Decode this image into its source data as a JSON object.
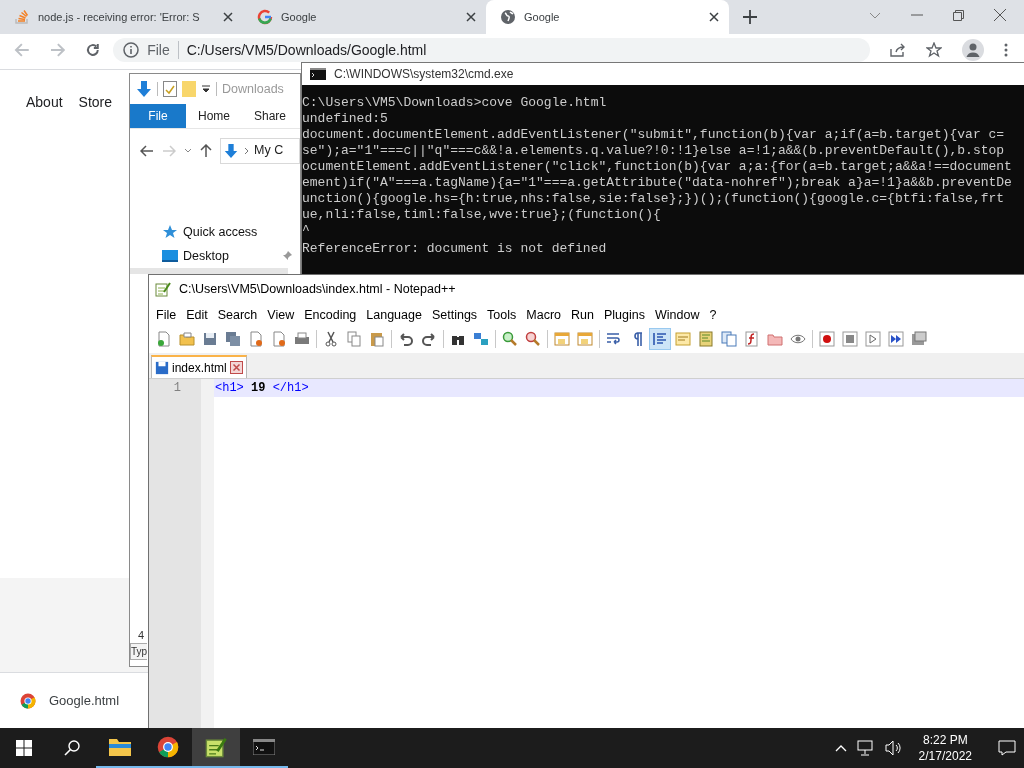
{
  "browser": {
    "tabs": [
      {
        "title": "node.js - receiving error: 'Error: S",
        "kind": "stack",
        "selected": false
      },
      {
        "title": "Google",
        "kind": "logo",
        "selected": false
      },
      {
        "title": "Google",
        "kind": "globe",
        "selected": true
      }
    ],
    "address": {
      "scheme": "File",
      "url": "C:/Users/VM5/Downloads/Google.html"
    },
    "page_links": [
      "About",
      "Store"
    ],
    "download": {
      "file": "Google.html"
    }
  },
  "explorer": {
    "title": "Downloads",
    "ribbon_tabs": [
      {
        "label": "File",
        "selected": true
      },
      {
        "label": "Home",
        "selected": false
      },
      {
        "label": "Share",
        "selected": false
      }
    ],
    "path": "My C",
    "nav": [
      {
        "label": "Quick access",
        "kind": "star",
        "pinned": false
      },
      {
        "label": "Desktop",
        "kind": "desktop",
        "pinned": true
      }
    ],
    "status_count": "4",
    "column_header": "Typ"
  },
  "console": {
    "title": "C:\\WINDOWS\\system32\\cmd.exe",
    "lines": [
      "C:\\Users\\VM5\\Downloads>cove Google.html",
      "undefined:5",
      "document.documentElement.addEventListener(\"submit\",function(b){var a;if(a=b.target){var c=",
      "se\");a=\"1\"===c||\"q\"===c&&!a.elements.q.value?!0:!1}else a=!1;a&&(b.preventDefault(),b.stop",
      "ocumentElement.addEventListener(\"click\",function(b){var a;a:{for(a=b.target;a&&a!==document",
      "ement)if(\"A\"===a.tagName){a=\"1\"===a.getAttribute(\"data-nohref\");break a}a=!1}a&&b.preventDe",
      "unction(){google.hs={h:true,nhs:false,sie:false};})();(function(){google.c={btfi:false,frt",
      "ue,nli:false,timl:false,wve:true};(function(){",
      "^"
    ],
    "error": "ReferenceError: document is not defined"
  },
  "notepad": {
    "title": "C:\\Users\\VM5\\Downloads\\index.html - Notepad++",
    "menu": [
      "File",
      "Edit",
      "Search",
      "View",
      "Encoding",
      "Language",
      "Settings",
      "Tools",
      "Macro",
      "Run",
      "Plugins",
      "Window",
      "?"
    ],
    "toolbar": [
      {
        "on": false
      },
      {
        "on": false
      },
      {
        "on": false
      },
      {
        "on": false
      },
      {
        "on": false
      },
      {
        "on": false
      },
      {
        "on": false
      },
      {
        "on": false
      },
      {
        "on": false
      },
      {
        "on": false
      },
      {
        "on": false
      },
      {
        "on": false
      },
      {
        "on": false
      },
      {
        "on": false
      },
      {
        "on": false
      },
      {
        "on": false
      },
      {
        "on": false
      },
      {
        "on": false
      },
      {
        "on": false
      },
      {
        "on": false
      },
      {
        "on": true
      },
      {
        "on": false
      },
      {
        "on": false
      },
      {
        "on": false
      },
      {
        "on": false
      },
      {
        "on": false
      },
      {
        "on": false
      },
      {
        "on": false
      },
      {
        "on": false
      },
      {
        "on": false
      },
      {
        "on": false
      },
      {
        "on": false
      }
    ],
    "tabs": [
      {
        "label": "index.html",
        "selected": true
      }
    ],
    "lines": [
      {
        "number": "1",
        "current": true,
        "tokens": [
          {
            "kind": "tag",
            "text": "<h1>"
          },
          {
            "kind": "text",
            "text": " 19 "
          },
          {
            "kind": "tag",
            "text": "</h1>"
          }
        ]
      }
    ]
  },
  "taskbar": {
    "apps": [
      {
        "kind": "folder",
        "active": false
      },
      {
        "kind": "chrome",
        "active": false
      },
      {
        "kind": "notepad",
        "active": true
      },
      {
        "kind": "console",
        "active": false
      }
    ],
    "time": "8:22 PM",
    "date": "2/17/2022"
  }
}
